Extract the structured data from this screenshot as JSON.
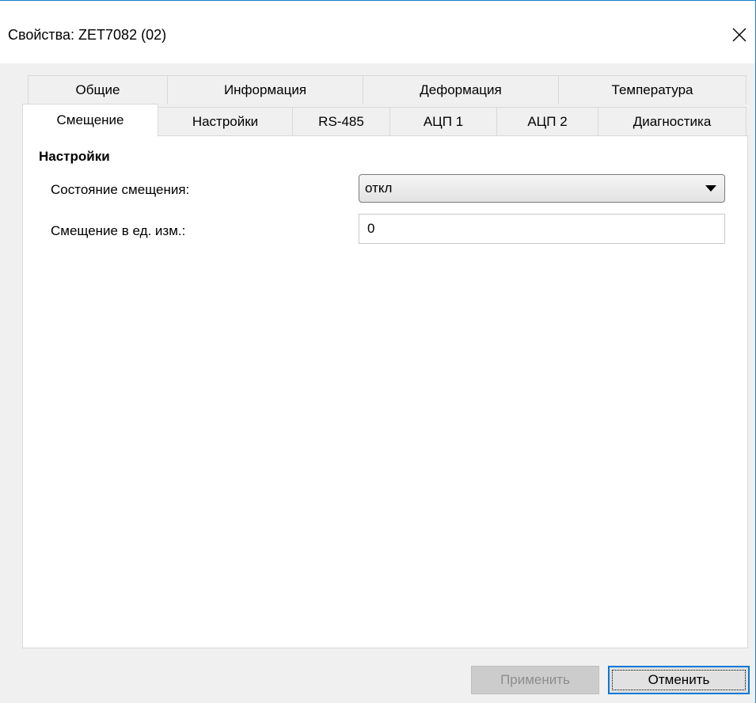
{
  "window": {
    "title": "Свойства: ZET7082 (02)"
  },
  "tabs": {
    "row1": [
      "Общие",
      "Информация",
      "Деформация",
      "Температура"
    ],
    "row2": [
      "Смещение",
      "Настройки",
      "RS-485",
      "АЦП 1",
      "АЦП 2",
      "Диагностика"
    ],
    "active": "Смещение"
  },
  "panel": {
    "section_title": "Настройки",
    "offset_state_label": "Состояние смещения:",
    "offset_state_value": "откл",
    "offset_units_label": "Смещение в ед. изм.:",
    "offset_units_value": "0"
  },
  "buttons": {
    "apply": "Применить",
    "cancel": "Отменить"
  },
  "icons": {
    "close": "close-icon",
    "dropdown": "chevron-down-icon"
  },
  "colors": {
    "accent": "#0078d7",
    "window_border": "#1883d7",
    "disabled_text": "#8d8d8d"
  }
}
